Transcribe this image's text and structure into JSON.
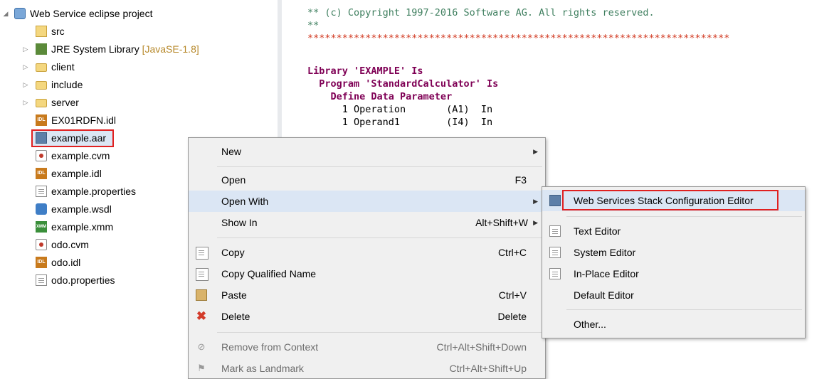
{
  "tree": {
    "project": {
      "label": "Web Service eclipse project"
    },
    "items": [
      {
        "label": "src",
        "decoration": ""
      },
      {
        "label": "JRE System Library",
        "decoration": "[JavaSE-1.8]"
      },
      {
        "label": "client",
        "decoration": ""
      },
      {
        "label": "include",
        "decoration": ""
      },
      {
        "label": "server",
        "decoration": ""
      },
      {
        "label": "EX01RDFN.idl",
        "decoration": ""
      },
      {
        "label": "example.aar",
        "decoration": ""
      },
      {
        "label": "example.cvm",
        "decoration": ""
      },
      {
        "label": "example.idl",
        "decoration": ""
      },
      {
        "label": "example.properties",
        "decoration": ""
      },
      {
        "label": "example.wsdl",
        "decoration": ""
      },
      {
        "label": "example.xmm",
        "decoration": ""
      },
      {
        "label": "odo.cvm",
        "decoration": ""
      },
      {
        "label": "odo.idl",
        "decoration": ""
      },
      {
        "label": "odo.properties",
        "decoration": ""
      }
    ],
    "icons": {
      "idl": "IDL",
      "xmm": "XMM"
    }
  },
  "editor": {
    "lines": [
      "** (c) Copyright 1997-2016 Software AG. All rights reserved.",
      "**",
      "*************************************************************************",
      "",
      "Library 'EXAMPLE' Is",
      "  Program 'StandardCalculator' Is",
      "    Define Data Parameter",
      "      1 Operation       (A1)  In",
      "      1 Operand1        (I4)  In"
    ]
  },
  "context_menu": {
    "items": [
      {
        "label": "New",
        "shortcut": ""
      },
      {
        "label": "Open",
        "shortcut": "F3"
      },
      {
        "label": "Open With",
        "shortcut": ""
      },
      {
        "label": "Show In",
        "shortcut": "Alt+Shift+W"
      },
      {
        "label": "Copy",
        "shortcut": "Ctrl+C"
      },
      {
        "label": "Copy Qualified Name",
        "shortcut": ""
      },
      {
        "label": "Paste",
        "shortcut": "Ctrl+V"
      },
      {
        "label": "Delete",
        "shortcut": "Delete"
      },
      {
        "label": "Remove from Context",
        "shortcut": "Ctrl+Alt+Shift+Down"
      },
      {
        "label": "Mark as Landmark",
        "shortcut": "Ctrl+Alt+Shift+Up"
      }
    ]
  },
  "open_with_menu": {
    "items": [
      {
        "label": "Web Services Stack Configuration Editor"
      },
      {
        "label": "Text Editor"
      },
      {
        "label": "System Editor"
      },
      {
        "label": "In-Place Editor"
      },
      {
        "label": "Default Editor"
      },
      {
        "label": "Other..."
      }
    ]
  },
  "colors": {
    "highlight": "#e02020",
    "menu_active": "#dbe6f4",
    "comment": "#3f7f5f",
    "keyword": "#7f0055"
  }
}
